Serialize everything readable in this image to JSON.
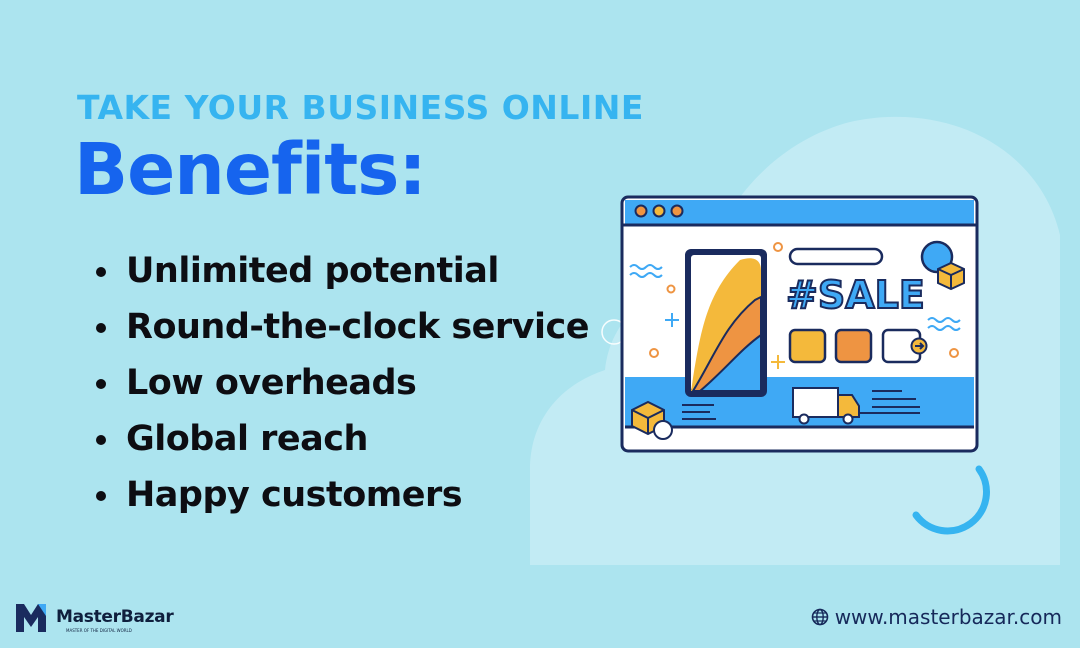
{
  "kicker": "TAKE YOUR BUSINESS ONLINE",
  "headline": "Benefits:",
  "benefits": [
    "Unlimited potential",
    "Round-the-clock service",
    "Low overheads",
    "Global reach",
    "Happy customers"
  ],
  "illustration": {
    "sale_text": "#SALE"
  },
  "brand": {
    "name": "MasterBazar",
    "tagline": "MASTER OF THE DIGITAL WORLD",
    "icon": "master-bazar-logo-icon"
  },
  "website": {
    "url": "www.masterbazar.com",
    "icon": "globe-icon"
  },
  "colors": {
    "background": "#ace4ef",
    "kicker": "#36b4f0",
    "headline": "#1664ee",
    "text": "#0d0d12",
    "accent_blue": "#3fa9f5",
    "yellow": "#f4b93b",
    "orange": "#ee9442",
    "navy": "#1a2b5e"
  }
}
